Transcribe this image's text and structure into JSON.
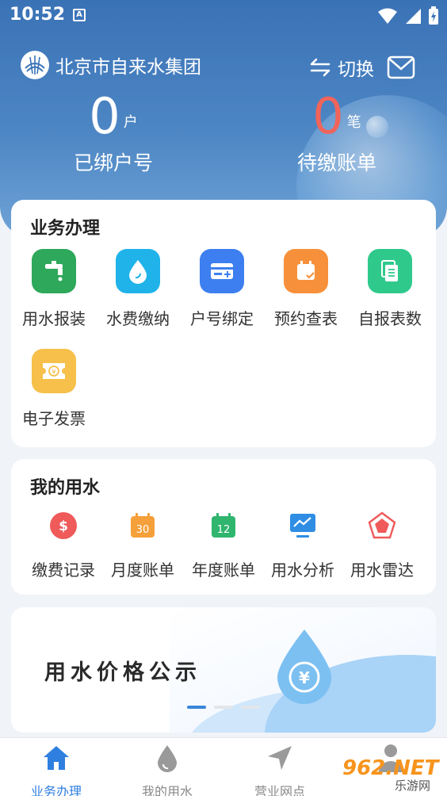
{
  "status_bar": {
    "time": "10:52",
    "notification_glyph": "A"
  },
  "header": {
    "brand": "北京市自来水集团",
    "switch_label": "切换",
    "bound_count": "0",
    "bound_unit": "户",
    "bound_label": "已绑户号",
    "bills_count": "0",
    "bills_unit": "笔",
    "bills_label": "待缴账单"
  },
  "services": {
    "title": "业务办理",
    "items": [
      {
        "label": "用水报装",
        "icon": "faucet-icon",
        "color": "#2ea85a"
      },
      {
        "label": "水费缴纳",
        "icon": "water-drop-icon",
        "color": "#1fb3ea"
      },
      {
        "label": "户号绑定",
        "icon": "card-add-icon",
        "color": "#3d7ff0"
      },
      {
        "label": "预约查表",
        "icon": "calendar-check-icon",
        "color": "#f7903a"
      },
      {
        "label": "自报表数",
        "icon": "copy-document-icon",
        "color": "#2fc98c"
      },
      {
        "label": "电子发票",
        "icon": "invoice-ticket-icon",
        "color": "#f6c04a"
      }
    ]
  },
  "my_water": {
    "title": "我的用水",
    "items": [
      {
        "label": "缴费记录",
        "icon": "dollar-circle-icon",
        "color": "#ef5a5a"
      },
      {
        "label": "月度账单",
        "icon": "calendar-30-icon",
        "color": "#f5a03a",
        "badge": "30"
      },
      {
        "label": "年度账单",
        "icon": "calendar-12-icon",
        "color": "#2fb56e",
        "badge": "12"
      },
      {
        "label": "用水分析",
        "icon": "chart-monitor-icon",
        "color": "#2f8de4"
      },
      {
        "label": "用水雷达",
        "icon": "radar-pentagon-icon",
        "color": "#ef5a5a"
      }
    ]
  },
  "banner": {
    "title": "用水价格公示",
    "currency_glyph": "¥",
    "slide_count": 3,
    "active_slide": 1
  },
  "bottom_nav": {
    "items": [
      {
        "label": "业务办理",
        "icon": "home-icon",
        "active": true
      },
      {
        "label": "我的用水",
        "icon": "water-drop-icon",
        "active": false
      },
      {
        "label": "营业网点",
        "icon": "navigation-arrow-icon",
        "active": false
      },
      {
        "label": "",
        "icon": "user-icon",
        "active": false
      }
    ]
  },
  "watermark": {
    "text": "962.NET",
    "sub": "乐游网"
  },
  "colors": {
    "header_blue": "#3a72b6",
    "accent_blue": "#2f7fe0",
    "pending_red": "#f0645a"
  }
}
